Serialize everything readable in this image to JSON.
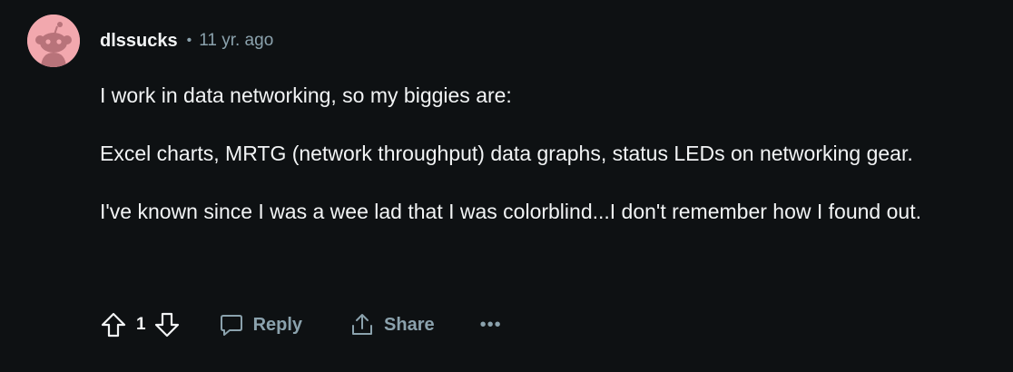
{
  "comment": {
    "author": "dlssucks",
    "separator": "•",
    "time": "11 yr. ago",
    "paragraphs": [
      "I work in data networking, so my biggies are:",
      "Excel charts, MRTG (network throughput) data graphs, status LEDs on networking gear.",
      "I've known since I was a wee lad that I was colorblind...I don't remember how I found out."
    ],
    "avatar_icon": "snoo-avatar-icon",
    "avatar_color": "#f2a8ae"
  },
  "actions": {
    "upvote_icon": "upvote-arrow-icon",
    "score": "1",
    "downvote_icon": "downvote-arrow-icon",
    "reply_label": "Reply",
    "reply_icon": "speech-bubble-icon",
    "share_label": "Share",
    "share_icon": "share-icon",
    "more_label": "•••"
  },
  "colors": {
    "background": "#0e1113",
    "text_primary": "#f2f4f5",
    "text_secondary": "#8ba2ad"
  }
}
